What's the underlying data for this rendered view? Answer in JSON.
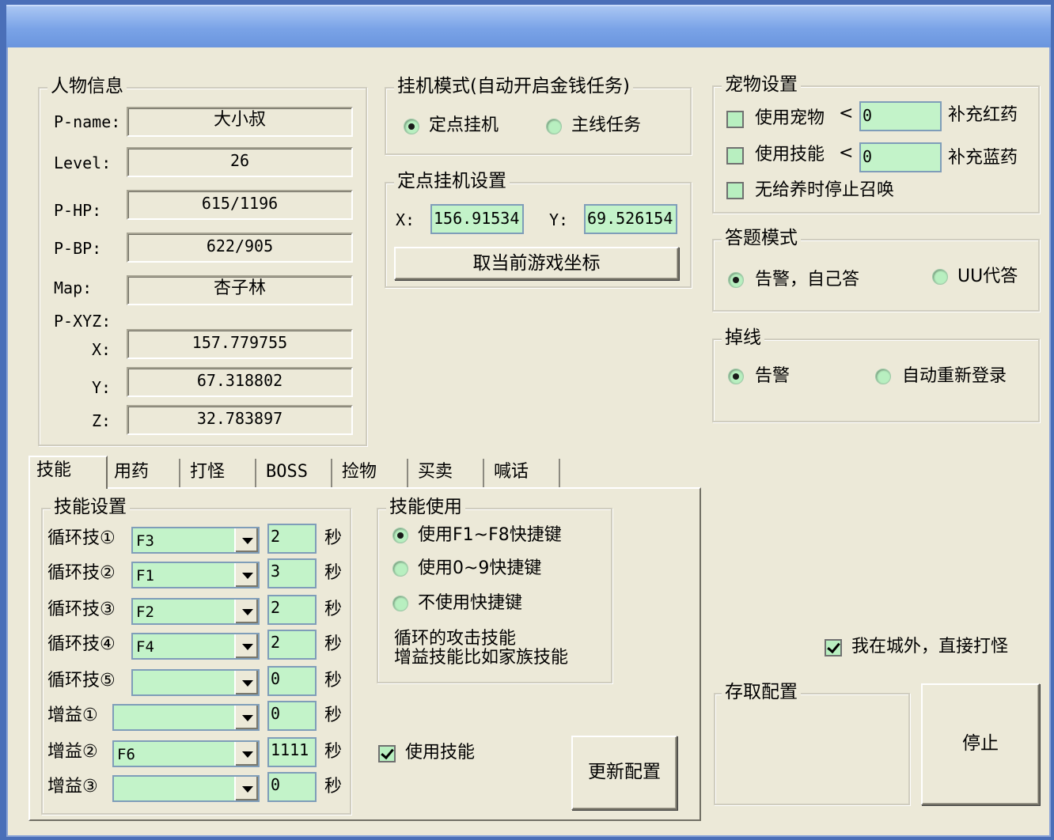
{
  "person": {
    "title": "人物信息",
    "fields": [
      {
        "label": "P-name:",
        "value": "大小叔"
      },
      {
        "label": "Level:",
        "value": "26"
      },
      {
        "label": "P-HP:",
        "value": "615/1196"
      },
      {
        "label": "P-BP:",
        "value": "622/905"
      },
      {
        "label": "Map:",
        "value": "杏子林"
      }
    ],
    "xyz_label": "P-XYZ:",
    "x_label": "X:",
    "x": "157.779755",
    "y_label": "Y:",
    "y": "67.318802",
    "z_label": "Z:",
    "z": "32.783897"
  },
  "mode": {
    "title": "挂机模式(自动开启金钱任务)",
    "opt1": "定点挂机",
    "opt2": "主线任务"
  },
  "fixed": {
    "title": "定点挂机设置",
    "x_label": "X:",
    "x": "156.91534",
    "y_label": "Y:",
    "y": "69.526154",
    "button": "取当前游戏坐标"
  },
  "pet": {
    "title": "宠物设置",
    "use_pet": "使用宠物",
    "lt1": "<",
    "val1": "0",
    "fill_red": "补充红药",
    "use_skill": "使用技能",
    "lt2": "<",
    "val2": "0",
    "fill_blue": "补充蓝药",
    "stop_summon": "无给养时停止召唤"
  },
  "answer": {
    "title": "答题模式",
    "opt1": "告警，自己答",
    "opt2": "UU代答"
  },
  "disconnect": {
    "title": "掉线",
    "opt1": "告警",
    "opt2": "自动重新登录"
  },
  "tabs": [
    "技能",
    "用药",
    "打怪",
    "BOSS",
    "捡物",
    "买卖",
    "喊话"
  ],
  "skills": {
    "title": "技能设置",
    "unit": "秒",
    "rows": [
      {
        "label": "循环技①",
        "key": "F3",
        "sec": "2"
      },
      {
        "label": "循环技②",
        "key": "F1",
        "sec": "3"
      },
      {
        "label": "循环技③",
        "key": "F2",
        "sec": "2"
      },
      {
        "label": "循环技④",
        "key": "F4",
        "sec": "2"
      },
      {
        "label": "循环技⑤",
        "key": "",
        "sec": "0"
      },
      {
        "label": "增益①",
        "key": "",
        "sec": "0"
      },
      {
        "label": "增益②",
        "key": "F6",
        "sec": "1111"
      },
      {
        "label": "增益③",
        "key": "",
        "sec": "0"
      }
    ]
  },
  "skill_use": {
    "title": "技能使用",
    "opt1": "使用F1~F8快捷键",
    "opt2": "使用0~9快捷键",
    "opt3": "不使用快捷键",
    "note1": "循环的攻击技能",
    "note2": "增益技能比如家族技能"
  },
  "use_skill_check": "使用技能",
  "update_button": "更新配置",
  "outside_check": "我在城外，直接打怪",
  "storage": {
    "title": "存取配置"
  },
  "stop_button": "停止"
}
